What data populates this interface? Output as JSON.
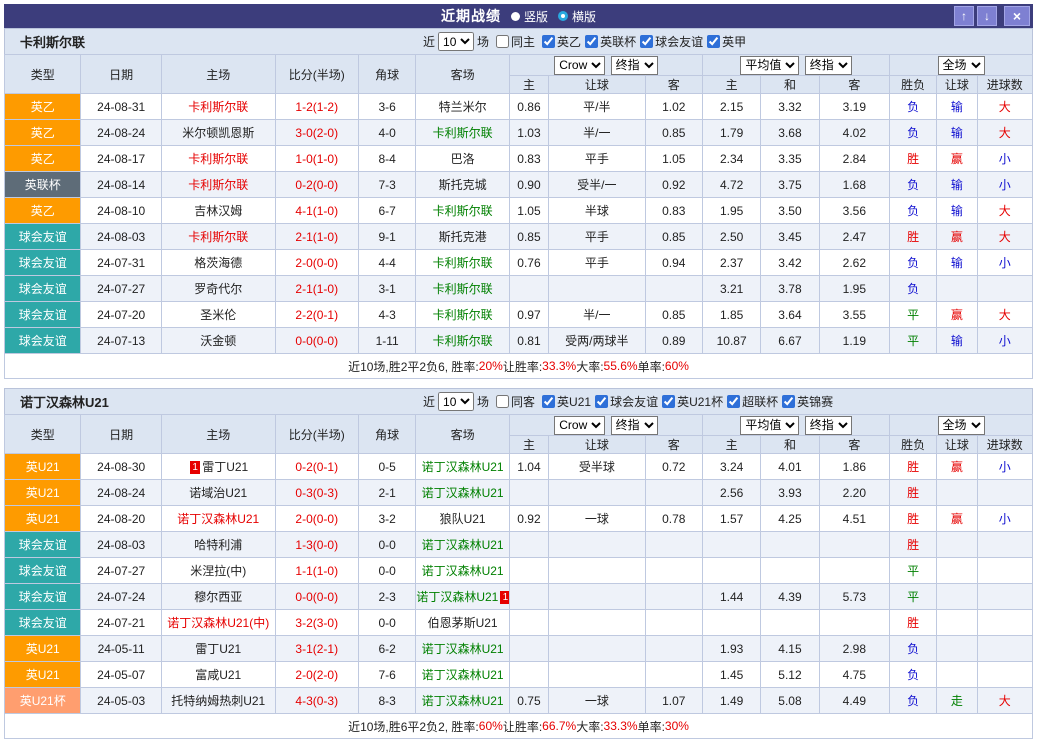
{
  "topbar": {
    "title": "近期战绩",
    "vertical_label": "竖版",
    "horizontal_label": "横版",
    "icons": {
      "up": "↑",
      "down": "↓",
      "close": "×"
    }
  },
  "filter_labels": {
    "near": "近",
    "games": "场"
  },
  "table_header": {
    "cols": [
      "类型",
      "日期",
      "主场",
      "比分(半场)",
      "角球",
      "客场"
    ],
    "bookmaker": "Crow",
    "stage": "终指",
    "avg": "平均值",
    "scope": "全场",
    "sub": [
      "主",
      "让球",
      "客",
      "主",
      "和",
      "客",
      "胜负",
      "让球",
      "进球数"
    ]
  },
  "colors": {
    "accent_bar": "#3c3d7c",
    "header_bg": "#dce5f2",
    "league_orange": "#fe9b00",
    "league_gray": "#5e6c78",
    "league_teal": "#2ea8a8",
    "league_salmon": "#ff9e6f",
    "win_red": "#e60000",
    "lose_blue": "#0f0fd0",
    "draw_green": "#008000"
  },
  "sections": [
    {
      "team": "卡利斯尔联",
      "filter": {
        "count": "10",
        "same": "同主",
        "leagues": [
          "英乙",
          "英联杯",
          "球会友谊",
          "英甲"
        ]
      },
      "rows": [
        {
          "lg": "英乙",
          "lgc": "orange",
          "dt": "24-08-31",
          "hm": "卡利斯尔联",
          "hmc": "red",
          "hmb": "",
          "sc": "1-2(1-2)",
          "cn": "3-6",
          "aw": "特兰米尔",
          "awc": "",
          "awb": "",
          "od": [
            "0.86",
            "平/半",
            "1.02"
          ],
          "av": [
            "2.15",
            "3.32",
            "3.19"
          ],
          "rs": [
            [
              "负",
              "blue"
            ],
            [
              "输",
              "blue"
            ],
            [
              "大",
              "red"
            ]
          ]
        },
        {
          "lg": "英乙",
          "lgc": "orange",
          "dt": "24-08-24",
          "hm": "米尔顿凯恩斯",
          "hmc": "",
          "hmb": "",
          "sc": "3-0(2-0)",
          "cn": "4-0",
          "aw": "卡利斯尔联",
          "awc": "green",
          "awb": "",
          "od": [
            "1.03",
            "半/一",
            "0.85"
          ],
          "av": [
            "1.79",
            "3.68",
            "4.02"
          ],
          "rs": [
            [
              "负",
              "blue"
            ],
            [
              "输",
              "blue"
            ],
            [
              "大",
              "red"
            ]
          ]
        },
        {
          "lg": "英乙",
          "lgc": "orange",
          "dt": "24-08-17",
          "hm": "卡利斯尔联",
          "hmc": "red",
          "hmb": "",
          "sc": "1-0(1-0)",
          "cn": "8-4",
          "aw": "巴洛",
          "awc": "",
          "awb": "",
          "od": [
            "0.83",
            "平手",
            "1.05"
          ],
          "av": [
            "2.34",
            "3.35",
            "2.84"
          ],
          "rs": [
            [
              "胜",
              "red"
            ],
            [
              "赢",
              "red"
            ],
            [
              "小",
              "blue"
            ]
          ]
        },
        {
          "lg": "英联杯",
          "lgc": "gray",
          "dt": "24-08-14",
          "hm": "卡利斯尔联",
          "hmc": "red",
          "hmb": "",
          "sc": "0-2(0-0)",
          "cn": "7-3",
          "aw": "斯托克城",
          "awc": "",
          "awb": "",
          "od": [
            "0.90",
            "受半/一",
            "0.92"
          ],
          "av": [
            "4.72",
            "3.75",
            "1.68"
          ],
          "rs": [
            [
              "负",
              "blue"
            ],
            [
              "输",
              "blue"
            ],
            [
              "小",
              "blue"
            ]
          ]
        },
        {
          "lg": "英乙",
          "lgc": "orange",
          "dt": "24-08-10",
          "hm": "吉林汉姆",
          "hmc": "",
          "hmb": "",
          "sc": "4-1(1-0)",
          "cn": "6-7",
          "aw": "卡利斯尔联",
          "awc": "green",
          "awb": "",
          "od": [
            "1.05",
            "半球",
            "0.83"
          ],
          "av": [
            "1.95",
            "3.50",
            "3.56"
          ],
          "rs": [
            [
              "负",
              "blue"
            ],
            [
              "输",
              "blue"
            ],
            [
              "大",
              "red"
            ]
          ]
        },
        {
          "lg": "球会友谊",
          "lgc": "teal",
          "dt": "24-08-03",
          "hm": "卡利斯尔联",
          "hmc": "red",
          "hmb": "",
          "sc": "2-1(1-0)",
          "cn": "9-1",
          "aw": "斯托克港",
          "awc": "",
          "awb": "",
          "od": [
            "0.85",
            "平手",
            "0.85"
          ],
          "av": [
            "2.50",
            "3.45",
            "2.47"
          ],
          "rs": [
            [
              "胜",
              "red"
            ],
            [
              "赢",
              "red"
            ],
            [
              "大",
              "red"
            ]
          ]
        },
        {
          "lg": "球会友谊",
          "lgc": "teal",
          "dt": "24-07-31",
          "hm": "格茨海德",
          "hmc": "",
          "hmb": "",
          "sc": "2-0(0-0)",
          "cn": "4-4",
          "aw": "卡利斯尔联",
          "awc": "green",
          "awb": "",
          "od": [
            "0.76",
            "平手",
            "0.94"
          ],
          "av": [
            "2.37",
            "3.42",
            "2.62"
          ],
          "rs": [
            [
              "负",
              "blue"
            ],
            [
              "输",
              "blue"
            ],
            [
              "小",
              "blue"
            ]
          ]
        },
        {
          "lg": "球会友谊",
          "lgc": "teal",
          "dt": "24-07-27",
          "hm": "罗奇代尔",
          "hmc": "",
          "hmb": "",
          "sc": "2-1(1-0)",
          "cn": "3-1",
          "aw": "卡利斯尔联",
          "awc": "green",
          "awb": "",
          "od": [
            "",
            "",
            ""
          ],
          "av": [
            "3.21",
            "3.78",
            "1.95"
          ],
          "rs": [
            [
              "负",
              "blue"
            ],
            [
              "",
              ""
            ],
            [
              "",
              ""
            ]
          ]
        },
        {
          "lg": "球会友谊",
          "lgc": "teal",
          "dt": "24-07-20",
          "hm": "圣米伦",
          "hmc": "",
          "hmb": "",
          "sc": "2-2(0-1)",
          "cn": "4-3",
          "aw": "卡利斯尔联",
          "awc": "green",
          "awb": "",
          "od": [
            "0.97",
            "半/一",
            "0.85"
          ],
          "av": [
            "1.85",
            "3.64",
            "3.55"
          ],
          "rs": [
            [
              "平",
              "green"
            ],
            [
              "赢",
              "red"
            ],
            [
              "大",
              "red"
            ]
          ]
        },
        {
          "lg": "球会友谊",
          "lgc": "teal",
          "dt": "24-07-13",
          "hm": "沃金顿",
          "hmc": "",
          "hmb": "",
          "sc": "0-0(0-0)",
          "cn": "1-11",
          "aw": "卡利斯尔联",
          "awc": "green",
          "awb": "",
          "od": [
            "0.81",
            "受两/两球半",
            "0.89"
          ],
          "av": [
            "10.87",
            "6.67",
            "1.19"
          ],
          "rs": [
            [
              "平",
              "green"
            ],
            [
              "输",
              "blue"
            ],
            [
              "小",
              "blue"
            ]
          ]
        }
      ],
      "summary": [
        [
          "近10场,胜2平2负6, 胜率:",
          "n"
        ],
        [
          "20%",
          "r"
        ],
        [
          " 让胜率:",
          "n"
        ],
        [
          "33.3%",
          "r"
        ],
        [
          " 大率:",
          "n"
        ],
        [
          "55.6%",
          "r"
        ],
        [
          " 单率:",
          "n"
        ],
        [
          "60%",
          "r"
        ]
      ]
    },
    {
      "team": "诺丁汉森林U21",
      "filter": {
        "count": "10",
        "same": "同客",
        "leagues": [
          "英U21",
          "球会友谊",
          "英U21杯",
          "超联杯",
          "英锦赛"
        ]
      },
      "rows": [
        {
          "lg": "英U21",
          "lgc": "orange",
          "dt": "24-08-30",
          "hm": "雷丁U21",
          "hmc": "",
          "hmb": "1",
          "sc": "0-2(0-1)",
          "cn": "0-5",
          "aw": "诺丁汉森林U21",
          "awc": "green",
          "awb": "",
          "od": [
            "1.04",
            "受半球",
            "0.72"
          ],
          "av": [
            "3.24",
            "4.01",
            "1.86"
          ],
          "rs": [
            [
              "胜",
              "red"
            ],
            [
              "赢",
              "red"
            ],
            [
              "小",
              "blue"
            ]
          ]
        },
        {
          "lg": "英U21",
          "lgc": "orange",
          "dt": "24-08-24",
          "hm": "诺域治U21",
          "hmc": "",
          "hmb": "",
          "sc": "0-3(0-3)",
          "cn": "2-1",
          "aw": "诺丁汉森林U21",
          "awc": "green",
          "awb": "",
          "od": [
            "",
            "",
            ""
          ],
          "av": [
            "2.56",
            "3.93",
            "2.20"
          ],
          "rs": [
            [
              "胜",
              "red"
            ],
            [
              "",
              ""
            ],
            [
              "",
              ""
            ]
          ]
        },
        {
          "lg": "英U21",
          "lgc": "orange",
          "dt": "24-08-20",
          "hm": "诺丁汉森林U21",
          "hmc": "red",
          "hmb": "",
          "sc": "2-0(0-0)",
          "cn": "3-2",
          "aw": "狼队U21",
          "awc": "",
          "awb": "",
          "od": [
            "0.92",
            "一球",
            "0.78"
          ],
          "av": [
            "1.57",
            "4.25",
            "4.51"
          ],
          "rs": [
            [
              "胜",
              "red"
            ],
            [
              "赢",
              "red"
            ],
            [
              "小",
              "blue"
            ]
          ]
        },
        {
          "lg": "球会友谊",
          "lgc": "teal",
          "dt": "24-08-03",
          "hm": "哈特利浦",
          "hmc": "",
          "hmb": "",
          "sc": "1-3(0-0)",
          "cn": "0-0",
          "aw": "诺丁汉森林U21",
          "awc": "green",
          "awb": "",
          "od": [
            "",
            "",
            ""
          ],
          "av": [
            "",
            "",
            ""
          ],
          "rs": [
            [
              "胜",
              "red"
            ],
            [
              "",
              ""
            ],
            [
              "",
              ""
            ]
          ]
        },
        {
          "lg": "球会友谊",
          "lgc": "teal",
          "dt": "24-07-27",
          "hm": "米涅拉(中)",
          "hmc": "",
          "hmb": "",
          "sc": "1-1(1-0)",
          "cn": "0-0",
          "aw": "诺丁汉森林U21",
          "awc": "green",
          "awb": "",
          "od": [
            "",
            "",
            ""
          ],
          "av": [
            "",
            "",
            ""
          ],
          "rs": [
            [
              "平",
              "green"
            ],
            [
              "",
              ""
            ],
            [
              "",
              ""
            ]
          ]
        },
        {
          "lg": "球会友谊",
          "lgc": "teal",
          "dt": "24-07-24",
          "hm": "穆尔西亚",
          "hmc": "",
          "hmb": "",
          "sc": "0-0(0-0)",
          "cn": "2-3",
          "aw": "诺丁汉森林U21",
          "awc": "green",
          "awb": "1",
          "od": [
            "",
            "",
            ""
          ],
          "av": [
            "1.44",
            "4.39",
            "5.73"
          ],
          "rs": [
            [
              "平",
              "green"
            ],
            [
              "",
              ""
            ],
            [
              "",
              ""
            ]
          ]
        },
        {
          "lg": "球会友谊",
          "lgc": "teal",
          "dt": "24-07-21",
          "hm": "诺丁汉森林U21(中)",
          "hmc": "red",
          "hmb": "",
          "sc": "3-2(3-0)",
          "cn": "0-0",
          "aw": "伯恩茅斯U21",
          "awc": "",
          "awb": "",
          "od": [
            "",
            "",
            ""
          ],
          "av": [
            "",
            "",
            ""
          ],
          "rs": [
            [
              "胜",
              "red"
            ],
            [
              "",
              ""
            ],
            [
              "",
              ""
            ]
          ]
        },
        {
          "lg": "英U21",
          "lgc": "orange",
          "dt": "24-05-11",
          "hm": "雷丁U21",
          "hmc": "",
          "hmb": "",
          "sc": "3-1(2-1)",
          "cn": "6-2",
          "aw": "诺丁汉森林U21",
          "awc": "green",
          "awb": "",
          "od": [
            "",
            "",
            ""
          ],
          "av": [
            "1.93",
            "4.15",
            "2.98"
          ],
          "rs": [
            [
              "负",
              "blue"
            ],
            [
              "",
              ""
            ],
            [
              "",
              ""
            ]
          ]
        },
        {
          "lg": "英U21",
          "lgc": "orange",
          "dt": "24-05-07",
          "hm": "富咸U21",
          "hmc": "",
          "hmb": "",
          "sc": "2-0(2-0)",
          "cn": "7-6",
          "aw": "诺丁汉森林U21",
          "awc": "green",
          "awb": "",
          "od": [
            "",
            "",
            ""
          ],
          "av": [
            "1.45",
            "5.12",
            "4.75"
          ],
          "rs": [
            [
              "负",
              "blue"
            ],
            [
              "",
              ""
            ],
            [
              "",
              ""
            ]
          ]
        },
        {
          "lg": "英U21杯",
          "lgc": "salmon",
          "dt": "24-05-03",
          "hm": "托特纳姆热刺U21",
          "hmc": "",
          "hmb": "",
          "sc": "4-3(0-3)",
          "cn": "8-3",
          "aw": "诺丁汉森林U21",
          "awc": "green",
          "awb": "",
          "od": [
            "0.75",
            "一球",
            "1.07"
          ],
          "av": [
            "1.49",
            "5.08",
            "4.49"
          ],
          "rs": [
            [
              "负",
              "blue"
            ],
            [
              "走",
              "green"
            ],
            [
              "大",
              "red"
            ]
          ]
        }
      ],
      "summary": [
        [
          "近10场,胜6平2负2, 胜率:",
          "n"
        ],
        [
          "60%",
          "r"
        ],
        [
          " 让胜率:",
          "n"
        ],
        [
          "66.7%",
          "r"
        ],
        [
          " 大率:",
          "n"
        ],
        [
          "33.3%",
          "r"
        ],
        [
          " 单率:",
          "n"
        ],
        [
          "30%",
          "r"
        ]
      ]
    }
  ]
}
